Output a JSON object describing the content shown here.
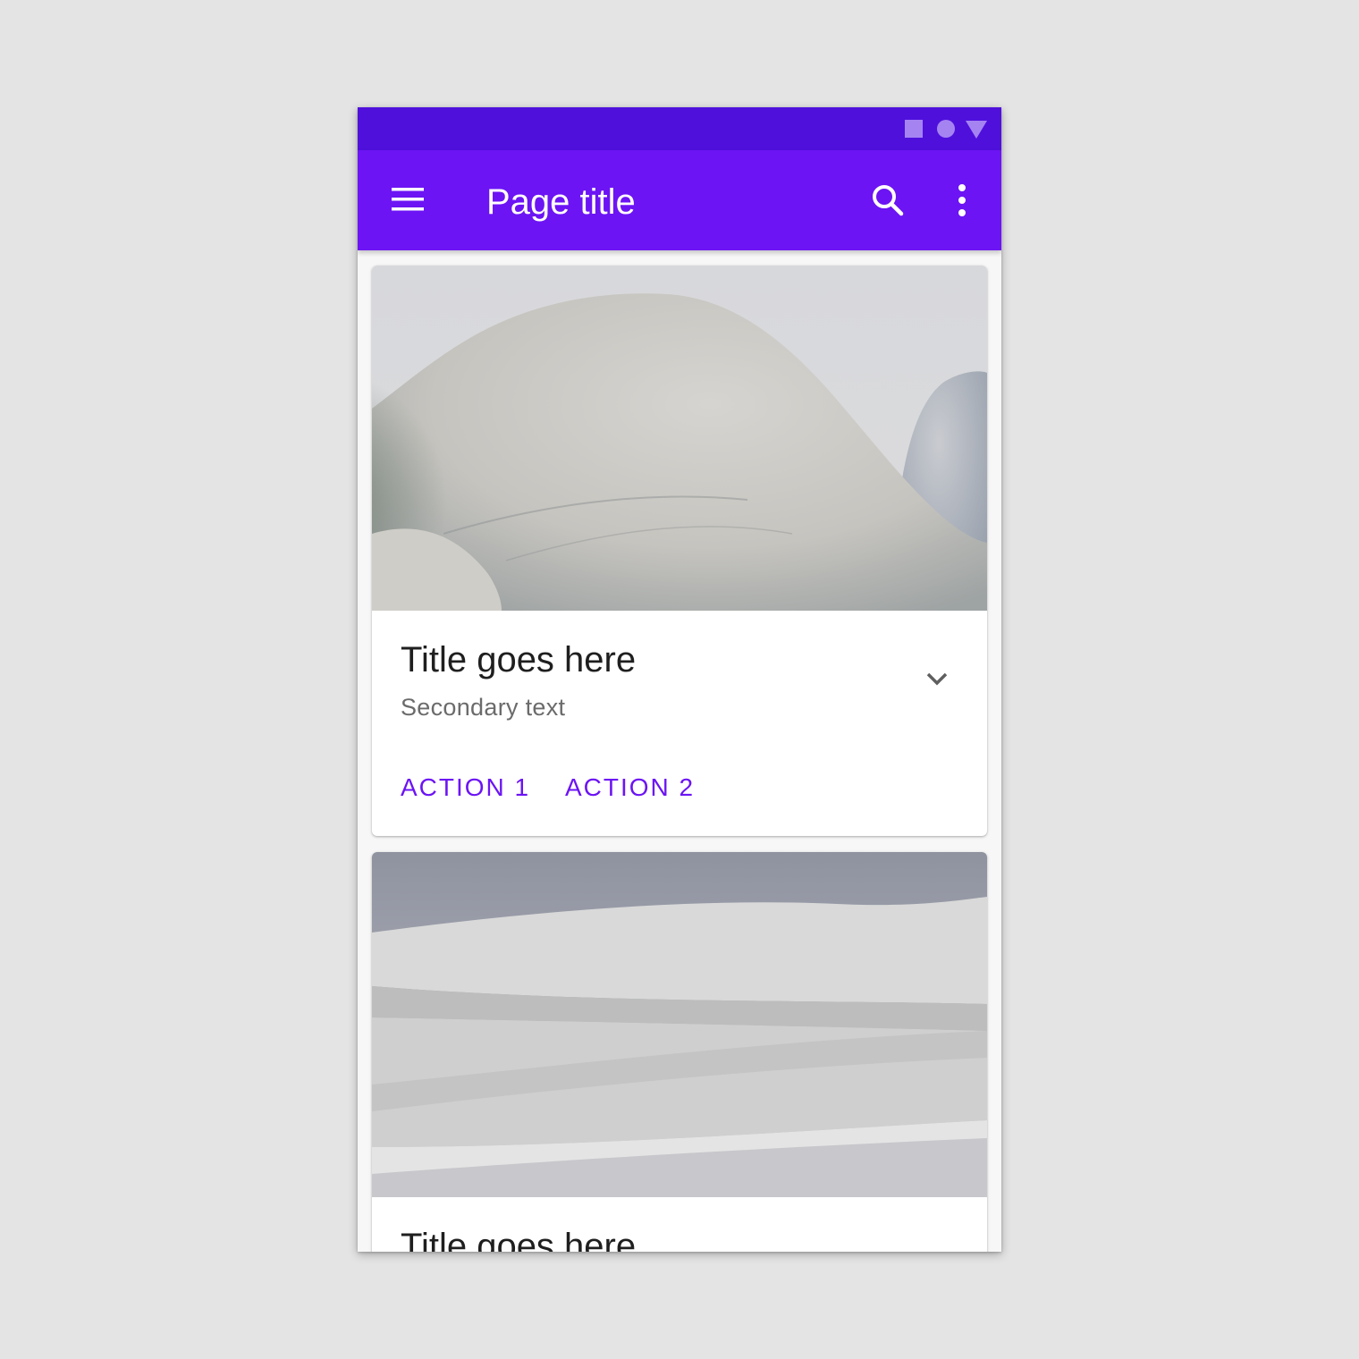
{
  "status_bar": {
    "icons": [
      "square-icon",
      "circle-icon",
      "triangle-icon"
    ],
    "background": "#4f10dc"
  },
  "app_bar": {
    "title": "Page title",
    "background": "#6c14f4",
    "nav_icon": "menu-icon",
    "action_icons": [
      "search-icon",
      "more-vert-icon"
    ]
  },
  "cards": [
    {
      "image": "rounded-boulders-photo",
      "title": "Title goes here",
      "secondary_text": "Secondary text",
      "expand_icon": "chevron-down-icon",
      "actions": [
        "ACTION 1",
        "ACTION 2"
      ]
    },
    {
      "image": "white-sand-dunes-photo",
      "title": "Title goes here"
    }
  ],
  "colors": {
    "accent": "#6c14f4",
    "status_bar": "#4f10dc",
    "page_background": "#e4e4e4",
    "surface": "#ffffff"
  }
}
